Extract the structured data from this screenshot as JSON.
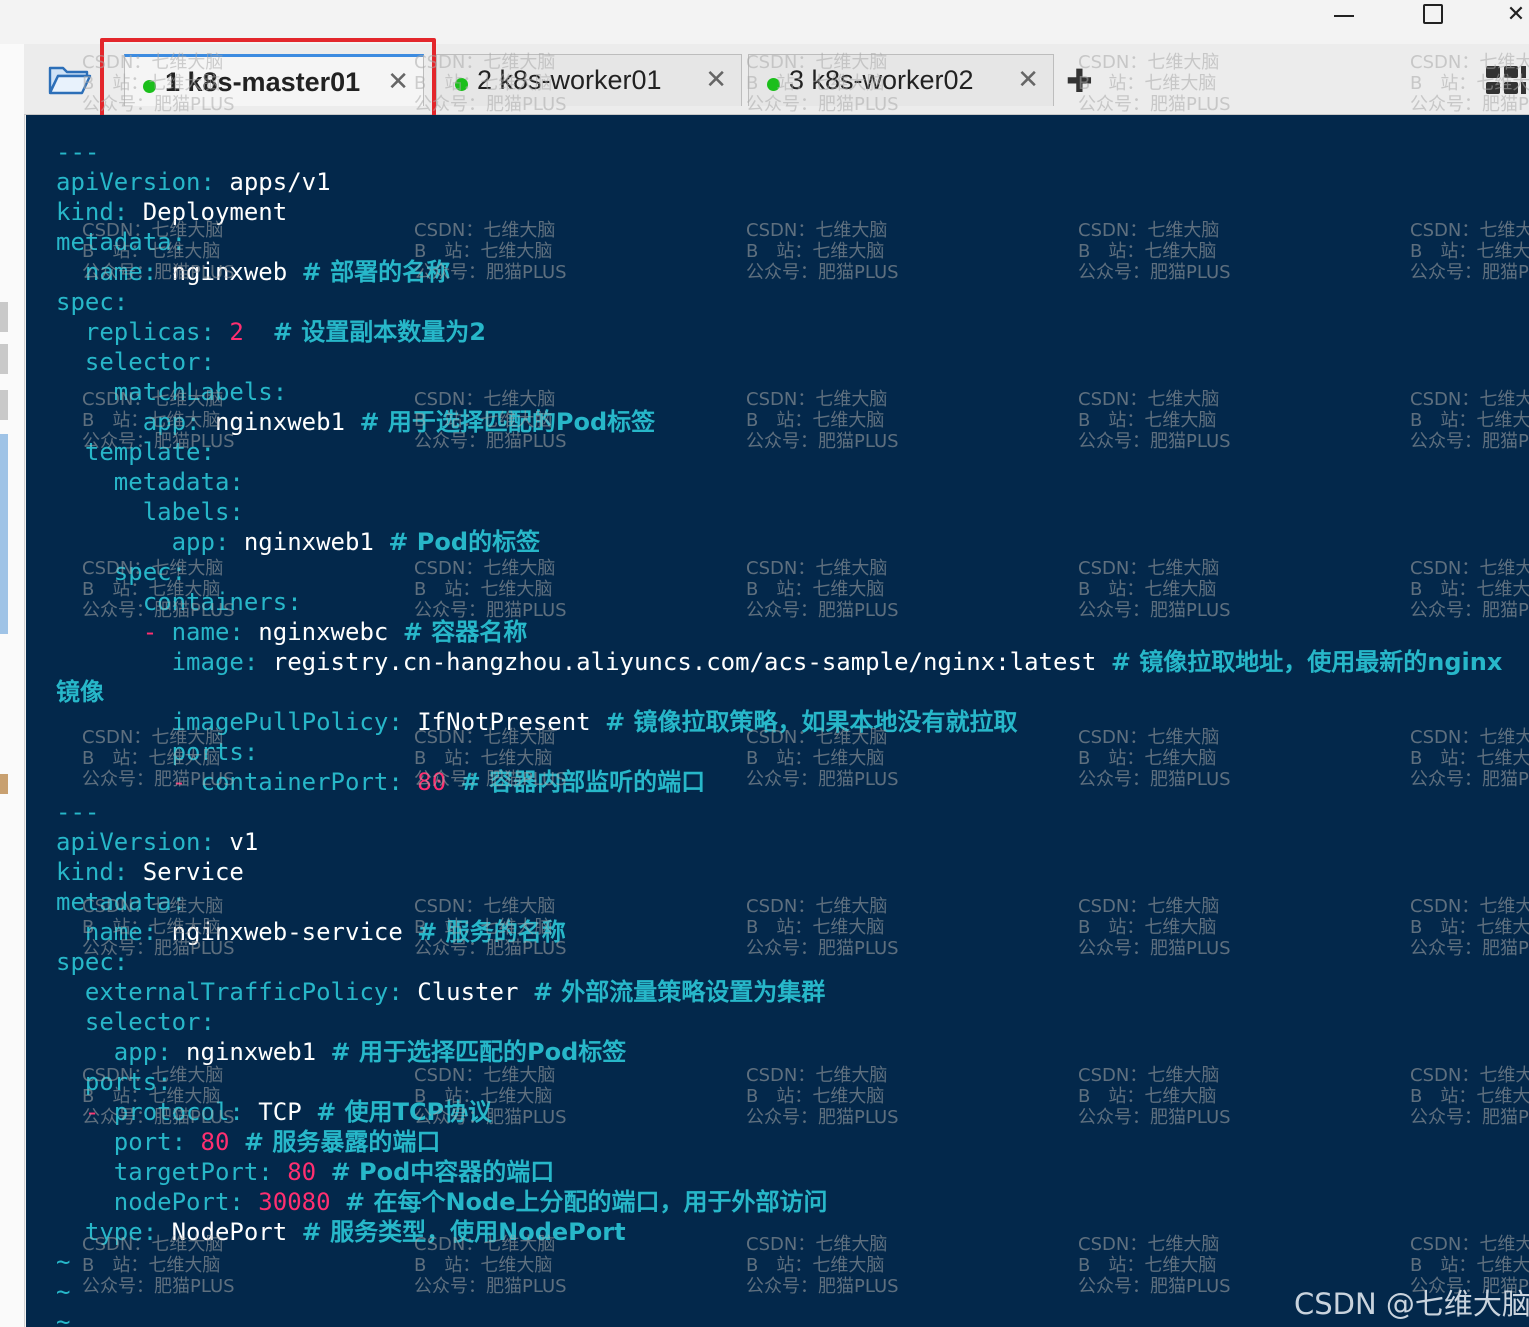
{
  "window": {
    "minimize_glyph": "",
    "maximize_glyph": "",
    "close_glyph": "✕"
  },
  "tabs": [
    {
      "label": "1 k8s-master01",
      "status": "connected",
      "close": "✕",
      "active": true
    },
    {
      "label": "2 k8s-worker01",
      "status": "connected",
      "close": "✕",
      "active": false
    },
    {
      "label": "3 k8s-worker02",
      "status": "connected",
      "close": "✕",
      "active": false
    }
  ],
  "toolbar": {
    "add_tab_glyph": "✚",
    "folder_icon": "folder-open-icon",
    "layout_icon": "grid-layout-icon"
  },
  "colors": {
    "terminal_bg": "#03284b",
    "key": "#27b7c9",
    "number": "#ff2f70",
    "value": "#ffffff",
    "highlight": "#e3262b",
    "status_dot": "#1bbf1b"
  },
  "terminal": {
    "lines": [
      [
        [
          "t",
          "---"
        ]
      ],
      [
        [
          "k",
          "apiVersion:"
        ],
        [
          "v",
          " apps/v1"
        ]
      ],
      [
        [
          "k",
          "kind:"
        ],
        [
          "v",
          " Deployment"
        ]
      ],
      [
        [
          "k",
          "metadata:"
        ]
      ],
      [
        [
          "v",
          "  "
        ],
        [
          "k",
          "name:"
        ],
        [
          "v",
          " nginxweb "
        ],
        [
          "c",
          "# 部署的名称"
        ]
      ],
      [
        [
          "k",
          "spec:"
        ]
      ],
      [
        [
          "v",
          "  "
        ],
        [
          "k",
          "replicas:"
        ],
        [
          "v",
          " "
        ],
        [
          "n",
          "2"
        ],
        [
          "v",
          "  "
        ],
        [
          "c",
          "# 设置副本数量为2"
        ]
      ],
      [
        [
          "v",
          "  "
        ],
        [
          "k",
          "selector:"
        ]
      ],
      [
        [
          "v",
          "    "
        ],
        [
          "k",
          "matchLabels:"
        ]
      ],
      [
        [
          "v",
          "      "
        ],
        [
          "k",
          "app:"
        ],
        [
          "v",
          " nginxweb1 "
        ],
        [
          "c",
          "# 用于选择匹配的Pod标签"
        ]
      ],
      [
        [
          "v",
          "  "
        ],
        [
          "k",
          "template:"
        ]
      ],
      [
        [
          "v",
          "    "
        ],
        [
          "k",
          "metadata:"
        ]
      ],
      [
        [
          "v",
          "      "
        ],
        [
          "k",
          "labels:"
        ]
      ],
      [
        [
          "v",
          "        "
        ],
        [
          "k",
          "app:"
        ],
        [
          "v",
          " nginxweb1 "
        ],
        [
          "c",
          "# Pod的标签"
        ]
      ],
      [
        [
          "v",
          "    "
        ],
        [
          "k",
          "spec:"
        ]
      ],
      [
        [
          "v",
          "      "
        ],
        [
          "k",
          "containers:"
        ]
      ],
      [
        [
          "v",
          "      "
        ],
        [
          "n",
          "- "
        ],
        [
          "k",
          "name:"
        ],
        [
          "v",
          " nginxwebc "
        ],
        [
          "c",
          "# 容器名称"
        ]
      ],
      [
        [
          "v",
          "        "
        ],
        [
          "k",
          "image:"
        ],
        [
          "v",
          " registry.cn-hangzhou.aliyuncs.com/acs-sample/nginx:latest "
        ],
        [
          "c",
          "# 镜像拉取地址，使用最新的nginx"
        ]
      ],
      [
        [
          "c",
          "镜像"
        ]
      ],
      [
        [
          "v",
          "        "
        ],
        [
          "k",
          "imagePullPolicy:"
        ],
        [
          "v",
          " IfNotPresent "
        ],
        [
          "c",
          "# 镜像拉取策略，如果本地没有就拉取"
        ]
      ],
      [
        [
          "v",
          "        "
        ],
        [
          "k",
          "ports:"
        ]
      ],
      [
        [
          "v",
          "        "
        ],
        [
          "n",
          "- "
        ],
        [
          "k",
          "containerPort:"
        ],
        [
          "v",
          " "
        ],
        [
          "n",
          "80"
        ],
        [
          "v",
          " "
        ],
        [
          "c",
          "# 容器内部监听的端口"
        ]
      ],
      [
        [
          "t",
          "---"
        ]
      ],
      [
        [
          "k",
          "apiVersion:"
        ],
        [
          "v",
          " v1"
        ]
      ],
      [
        [
          "k",
          "kind:"
        ],
        [
          "v",
          " Service"
        ]
      ],
      [
        [
          "k",
          "metadata:"
        ]
      ],
      [
        [
          "v",
          "  "
        ],
        [
          "k",
          "name:"
        ],
        [
          "v",
          " nginxweb-service "
        ],
        [
          "c",
          "# 服务的名称"
        ]
      ],
      [
        [
          "k",
          "spec:"
        ]
      ],
      [
        [
          "v",
          "  "
        ],
        [
          "k",
          "externalTrafficPolicy:"
        ],
        [
          "v",
          " Cluster "
        ],
        [
          "c",
          "# 外部流量策略设置为集群"
        ]
      ],
      [
        [
          "v",
          "  "
        ],
        [
          "k",
          "selector:"
        ]
      ],
      [
        [
          "v",
          "    "
        ],
        [
          "k",
          "app:"
        ],
        [
          "v",
          " nginxweb1 "
        ],
        [
          "c",
          "# 用于选择匹配的Pod标签"
        ]
      ],
      [
        [
          "v",
          "  "
        ],
        [
          "k",
          "ports:"
        ]
      ],
      [
        [
          "v",
          "  "
        ],
        [
          "n",
          "- "
        ],
        [
          "k",
          "protocol:"
        ],
        [
          "v",
          " TCP "
        ],
        [
          "c",
          "# 使用TCP协议"
        ]
      ],
      [
        [
          "v",
          "    "
        ],
        [
          "k",
          "port:"
        ],
        [
          "v",
          " "
        ],
        [
          "n",
          "80"
        ],
        [
          "v",
          " "
        ],
        [
          "c",
          "# 服务暴露的端口"
        ]
      ],
      [
        [
          "v",
          "    "
        ],
        [
          "k",
          "targetPort:"
        ],
        [
          "v",
          " "
        ],
        [
          "n",
          "80"
        ],
        [
          "v",
          " "
        ],
        [
          "c",
          "# Pod中容器的端口"
        ]
      ],
      [
        [
          "v",
          "    "
        ],
        [
          "k",
          "nodePort:"
        ],
        [
          "v",
          " "
        ],
        [
          "n",
          "30080"
        ],
        [
          "v",
          " "
        ],
        [
          "c",
          "# 在每个Node上分配的端口，用于外部访问"
        ]
      ],
      [
        [
          "v",
          "  "
        ],
        [
          "k",
          "type:"
        ],
        [
          "v",
          " NodePort "
        ],
        [
          "c",
          "# 服务类型，使用NodePort"
        ]
      ],
      [
        [
          "t",
          "~"
        ]
      ],
      [
        [
          "t",
          "~"
        ]
      ],
      [
        [
          "t",
          "~"
        ]
      ]
    ]
  },
  "watermark": {
    "line1": "CSDN：七维大脑",
    "line2": "B　站：七维大脑",
    "line3": "公众号：肥猫PLUS"
  },
  "footer_watermark": "CSDN @七维大脑"
}
